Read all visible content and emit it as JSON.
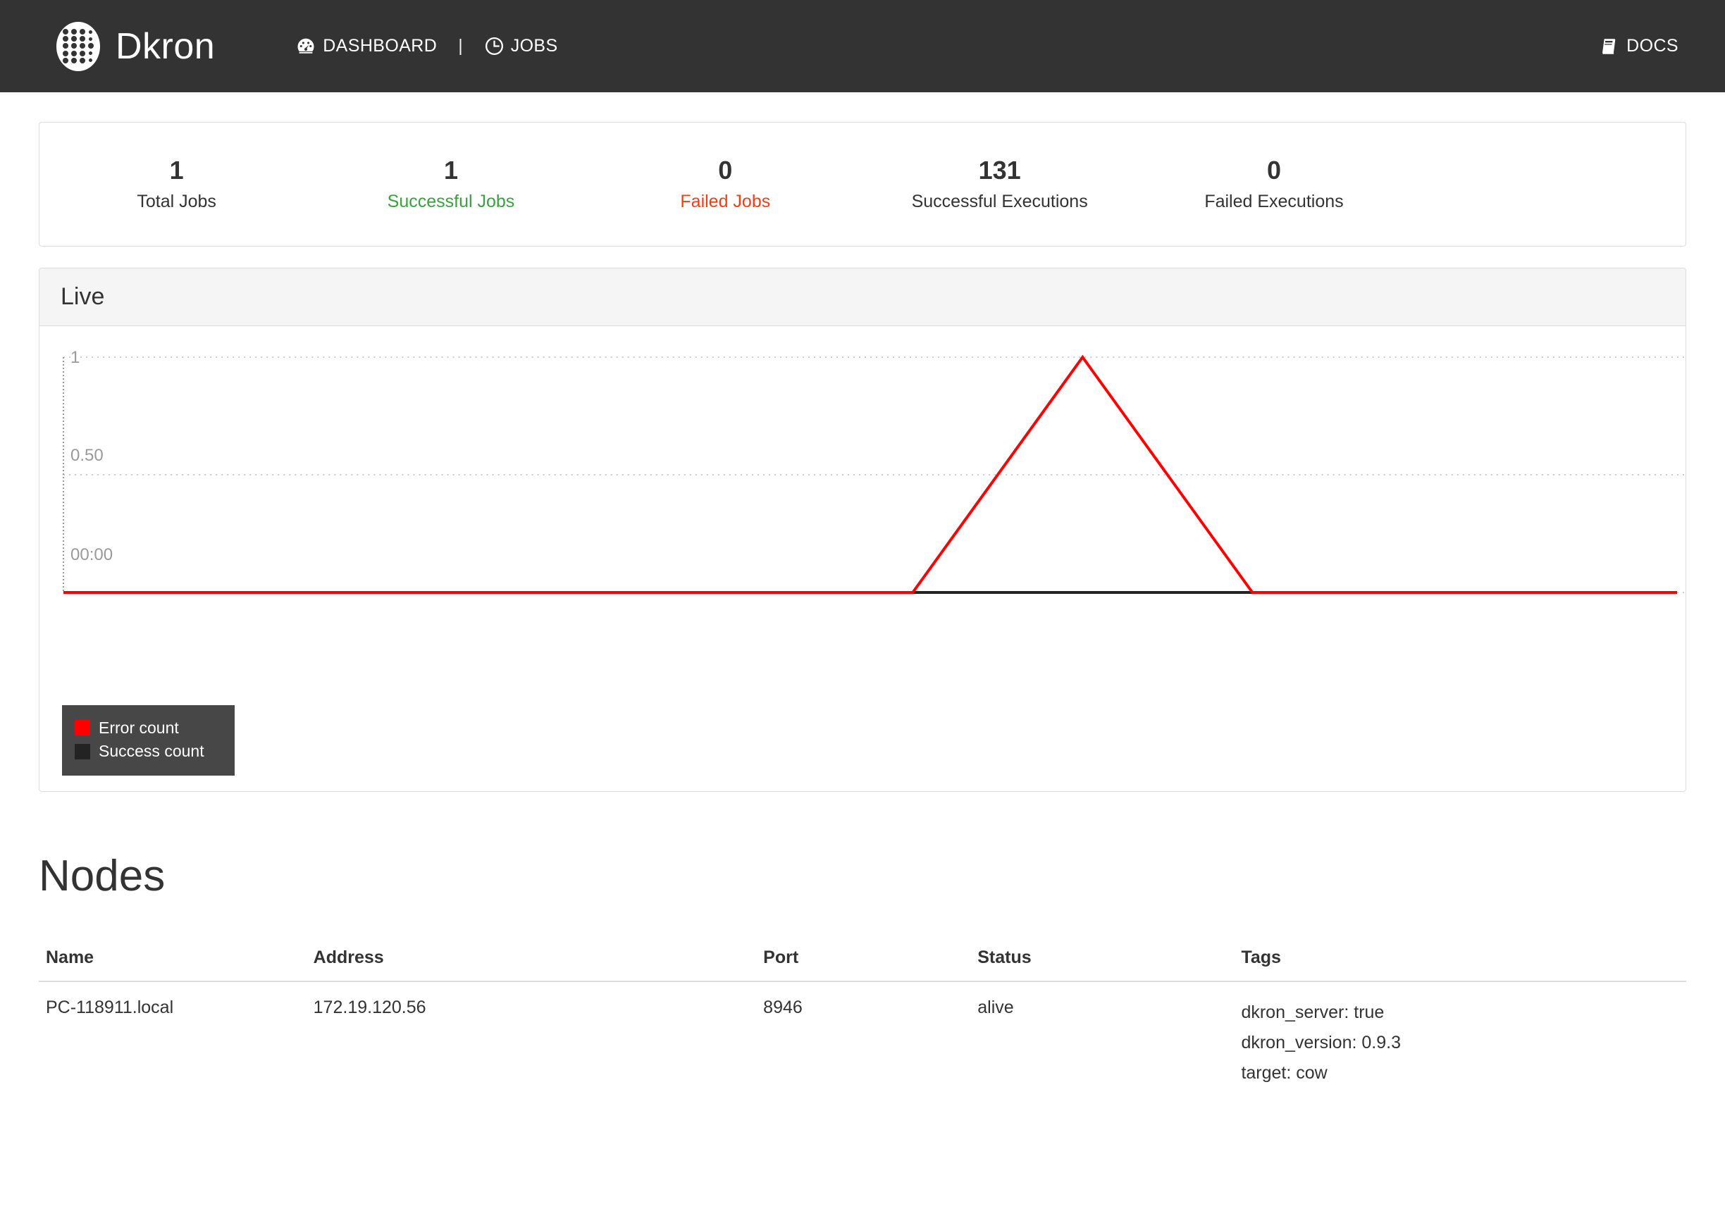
{
  "navbar": {
    "brand": "Dkron",
    "brand_icon": "dkron-dots-logo-icon",
    "links": [
      {
        "label": "DASHBOARD",
        "icon": "speedometer-icon"
      },
      {
        "label": "JOBS",
        "icon": "clock-icon"
      }
    ],
    "separator": "|",
    "docs": {
      "label": "DOCS",
      "icon": "book-icon"
    },
    "background": "#333333"
  },
  "stats": [
    {
      "value": "1",
      "label": "Total Jobs",
      "color": "#333333"
    },
    {
      "value": "1",
      "label": "Successful Jobs",
      "color": "#3c9f40"
    },
    {
      "value": "0",
      "label": "Failed Jobs",
      "color": "#e8411c"
    },
    {
      "value": "131",
      "label": "Successful Executions",
      "color": "#333333"
    },
    {
      "value": "0",
      "label": "Failed Executions",
      "color": "#333333"
    }
  ],
  "live_panel": {
    "title": "Live"
  },
  "chart_data": {
    "type": "line",
    "title": "Live",
    "xlabel": "",
    "ylabel": "",
    "ylim": [
      0,
      1
    ],
    "yticks": [
      "0.50"
    ],
    "ytick_top": "1",
    "xticks": [
      "00:00"
    ],
    "grid": true,
    "legend_position": "bottom-left",
    "legend": [
      {
        "name": "Error count",
        "color": "#ff0000"
      },
      {
        "name": "Success count",
        "color": "#232323"
      }
    ],
    "x": [
      0,
      1,
      2,
      3,
      4,
      5,
      6,
      7,
      8,
      9,
      10,
      11,
      12,
      13,
      14,
      15,
      16,
      17,
      18,
      19
    ],
    "series": [
      {
        "name": "Error count",
        "color": "#ff0000",
        "values": [
          0,
          0,
          0,
          0,
          0,
          0,
          0,
          0,
          0,
          0,
          0,
          0.5,
          1,
          0.5,
          0,
          0,
          0,
          0,
          0,
          0
        ]
      },
      {
        "name": "Success count",
        "color": "#232323",
        "values": [
          0,
          0,
          0,
          0,
          0,
          0,
          0,
          0,
          0,
          0,
          0,
          0,
          0,
          0,
          0,
          0,
          0,
          0,
          0,
          0
        ]
      }
    ]
  },
  "nodes": {
    "title": "Nodes",
    "columns": [
      "Name",
      "Address",
      "Port",
      "Status",
      "Tags"
    ],
    "rows": [
      {
        "name": "PC-118911.local",
        "address": "172.19.120.56",
        "port": "8946",
        "status": "alive",
        "tags": [
          "dkron_server: true",
          "dkron_version: 0.9.3",
          "target: cow"
        ]
      }
    ]
  }
}
